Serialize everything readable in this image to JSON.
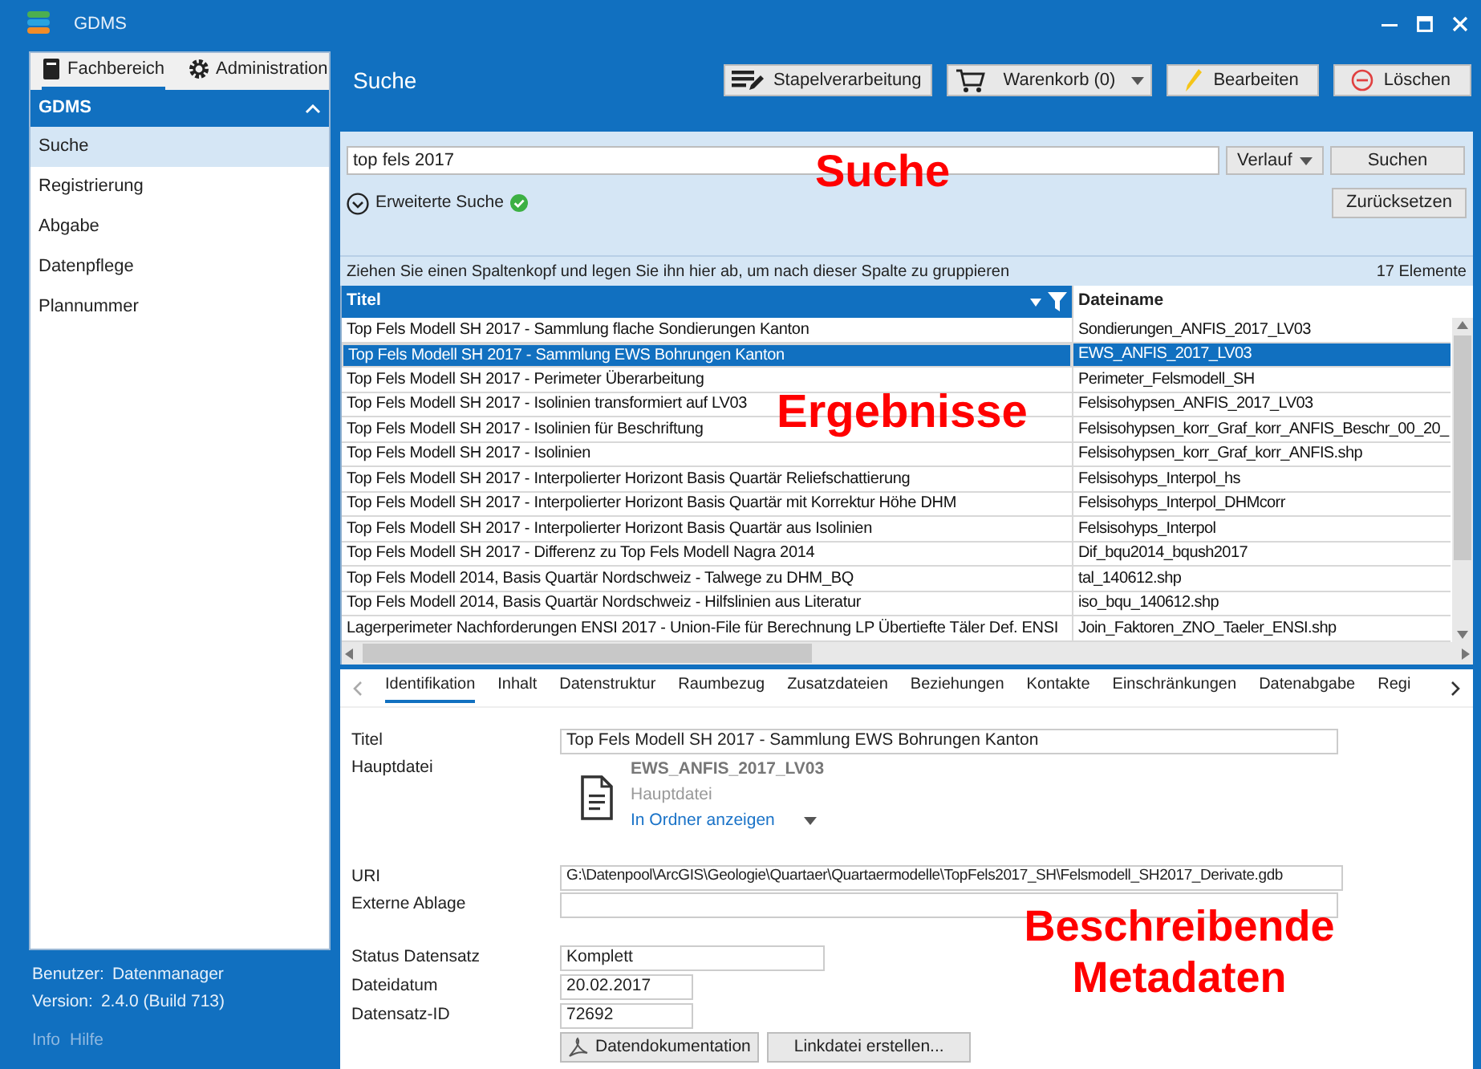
{
  "window": {
    "title": "GDMS"
  },
  "sidebar": {
    "tabs": [
      {
        "label": "Fachbereich",
        "kind": "book",
        "selected": true
      },
      {
        "label": "Administration",
        "kind": "gear",
        "selected": false
      }
    ],
    "section": {
      "title": "GDMS",
      "expanded": true
    },
    "items": [
      {
        "label": "Suche",
        "selected": true
      },
      {
        "label": "Registrierung",
        "selected": false
      },
      {
        "label": "Abgabe",
        "selected": false
      },
      {
        "label": "Datenpflege",
        "selected": false
      },
      {
        "label": "Plannummer",
        "selected": false
      }
    ],
    "user_label": "Benutzer:",
    "user": "Datenmanager",
    "version_label": "Version:",
    "version": "2.4.0 (Build 713)",
    "links": [
      "Info",
      "Hilfe"
    ]
  },
  "page_title": "Suche",
  "toolbar": [
    {
      "label": "Stapelverarbeitung",
      "kind": "batch"
    },
    {
      "label": "Warenkorb (0)",
      "kind": "cart"
    },
    {
      "label": "Bearbeiten",
      "kind": "edit"
    },
    {
      "label": "Löschen",
      "kind": "delete"
    }
  ],
  "search": {
    "value": "top fels 2017",
    "history_button": "Verlauf",
    "search_button": "Suchen",
    "advanced_label": "Erweiterte Suche",
    "advanced_valid": true,
    "reset_button": "Zurücksetzen"
  },
  "group_hint": "Ziehen Sie einen Spaltenkopf und legen Sie ihn hier ab, um nach dieser Spalte zu gruppieren",
  "count": "17 Elemente",
  "table": {
    "columns": [
      {
        "label": "Titel",
        "filter": true
      },
      {
        "label": "Dateiname",
        "filter": false
      }
    ],
    "rows": [
      {
        "title": "Top Fels Modell SH 2017 - Sammlung flache Sondierungen Kanton",
        "file": "Sondierungen_ANFIS_2017_LV03",
        "selected": false
      },
      {
        "title": "Top Fels Modell SH 2017 - Sammlung EWS Bohrungen Kanton",
        "file": "EWS_ANFIS_2017_LV03",
        "selected": true
      },
      {
        "title": "Top Fels Modell SH 2017 - Perimeter Überarbeitung",
        "file": "Perimeter_Felsmodell_SH",
        "selected": false
      },
      {
        "title": "Top Fels Modell SH 2017 - Isolinien transformiert auf LV03",
        "file": "Felsisohypsen_ANFIS_2017_LV03",
        "selected": false
      },
      {
        "title": "Top Fels Modell SH 2017 - Isolinien für Beschriftung",
        "file": "Felsisohypsen_korr_Graf_korr_ANFIS_Beschr_00_20_",
        "selected": false
      },
      {
        "title": "Top Fels Modell SH 2017 - Isolinien",
        "file": "Felsisohypsen_korr_Graf_korr_ANFIS.shp",
        "selected": false
      },
      {
        "title": "Top Fels Modell SH 2017 - Interpolierter Horizont Basis Quartär Reliefschattierung",
        "file": "Felsisohyps_Interpol_hs",
        "selected": false
      },
      {
        "title": "Top Fels Modell SH 2017 - Interpolierter Horizont Basis Quartär mit Korrektur Höhe DHM",
        "file": "Felsisohyps_Interpol_DHMcorr",
        "selected": false
      },
      {
        "title": "Top Fels Modell SH 2017 - Interpolierter Horizont Basis Quartär aus Isolinien",
        "file": "Felsisohyps_Interpol",
        "selected": false
      },
      {
        "title": "Top Fels Modell SH 2017 - Differenz zu Top Fels Modell Nagra 2014",
        "file": "Dif_bqu2014_bqush2017",
        "selected": false
      },
      {
        "title": "Top Fels Modell 2014, Basis Quartär Nordschweiz - Talwege zu DHM_BQ",
        "file": "tal_140612.shp",
        "selected": false
      },
      {
        "title": "Top Fels Modell 2014, Basis Quartär Nordschweiz - Hilfslinien aus Literatur",
        "file": "iso_bqu_140612.shp",
        "selected": false
      },
      {
        "title": "Lagerperimeter Nachforderungen ENSI 2017 - Union-File für Berechnung LP Übertiefte Täler Def. ENSI",
        "file": "Join_Faktoren_ZNO_Taeler_ENSI.shp",
        "selected": false
      }
    ]
  },
  "detail": {
    "tabs": [
      {
        "label": "Identifikation",
        "selected": true
      },
      {
        "label": "Inhalt",
        "selected": false
      },
      {
        "label": "Datenstruktur",
        "selected": false
      },
      {
        "label": "Raumbezug",
        "selected": false
      },
      {
        "label": "Zusatzdateien",
        "selected": false
      },
      {
        "label": "Beziehungen",
        "selected": false
      },
      {
        "label": "Kontakte",
        "selected": false
      },
      {
        "label": "Einschränkungen",
        "selected": false
      },
      {
        "label": "Datenabgabe",
        "selected": false
      },
      {
        "label": "Regi",
        "selected": false
      }
    ],
    "title_label": "Titel",
    "title_value": "Top Fels Modell SH 2017 - Sammlung EWS Bohrungen Kanton",
    "main_file_label": "Hauptdatei",
    "main_file": "EWS_ANFIS_2017_LV03",
    "main_file_caption": "Hauptdatei",
    "open_folder": "In Ordner anzeigen",
    "uri_label": "URI",
    "uri_value": "G:\\Datenpool\\ArcGIS\\Geologie\\Quartaer\\Quartaermodelle\\TopFels2017_SH\\Felsmodell_SH2017_Derivate.gdb",
    "external_label": "Externe Ablage",
    "status_label": "Status Datensatz",
    "status_value": "Komplett",
    "date_label": "Dateidatum",
    "date_value": "20.02.2017",
    "id_label": "Datensatz-ID",
    "id_value": "72692",
    "doc_button": "Datendokumentation",
    "link_button": "Linkdatei erstellen..."
  },
  "annotations": [
    "Suche",
    "Ergebnisse",
    "Beschreibende Metadaten"
  ]
}
